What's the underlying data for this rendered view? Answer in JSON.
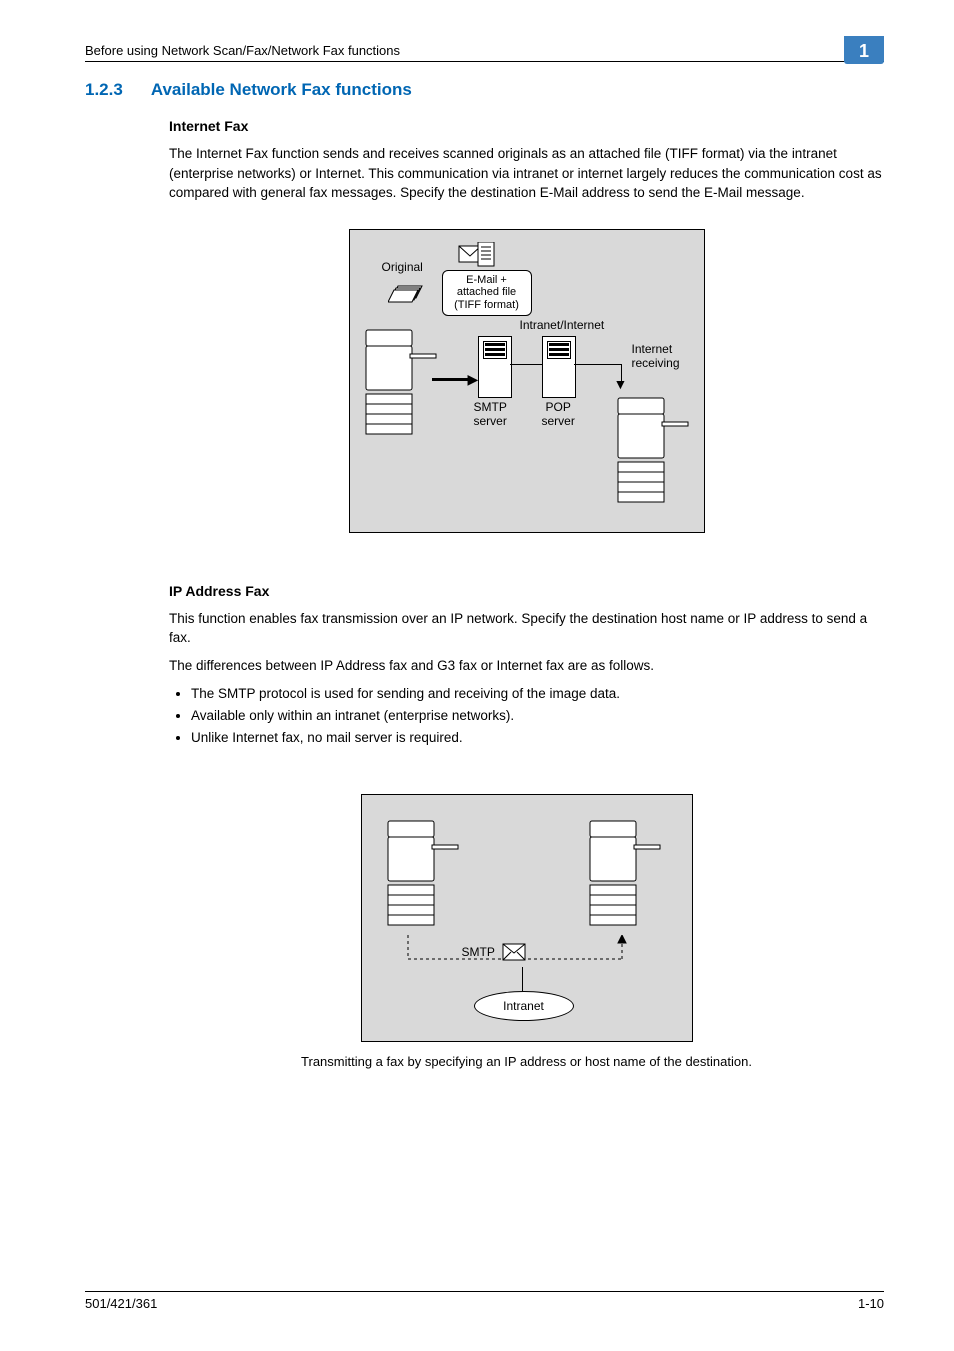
{
  "header": {
    "running_head": "Before using Network Scan/Fax/Network Fax functions",
    "chapter_no": "1"
  },
  "section": {
    "number": "1.2.3",
    "title": "Available Network Fax functions"
  },
  "internet_fax": {
    "heading": "Internet Fax",
    "para": "The Internet Fax function sends and receives scanned originals as an attached file (TIFF format) via the intranet (enterprise networks) or Internet. This communication via intranet or internet largely reduces the communication cost as compared with general fax messages. Specify the destination E-Mail address to send the E-Mail message."
  },
  "fig1_labels": {
    "original": "Original",
    "callout": "E-Mail +\nattached file\n(TIFF format)",
    "intranet": "Intranet/Internet",
    "smtp": "SMTP\nserver",
    "pop": "POP\nserver",
    "receiving": "Internet\nreceiving"
  },
  "ip_fax": {
    "heading": "IP Address Fax",
    "para1": "This function enables fax transmission over an IP network. Specify the destination host name or IP address to send a fax.",
    "para2": "The differences between IP Address fax and G3 fax or Internet fax are as follows.",
    "bullets": [
      "The SMTP protocol is used for sending and receiving of the image data.",
      "Available only within an intranet (enterprise networks).",
      "Unlike Internet fax, no mail server is required."
    ]
  },
  "fig2_labels": {
    "smtp": "SMTP",
    "intranet": "Intranet"
  },
  "caption2": "Transmitting a fax by specifying an IP address or host name of the destination.",
  "footer": {
    "left": "501/421/361",
    "right": "1-10"
  }
}
